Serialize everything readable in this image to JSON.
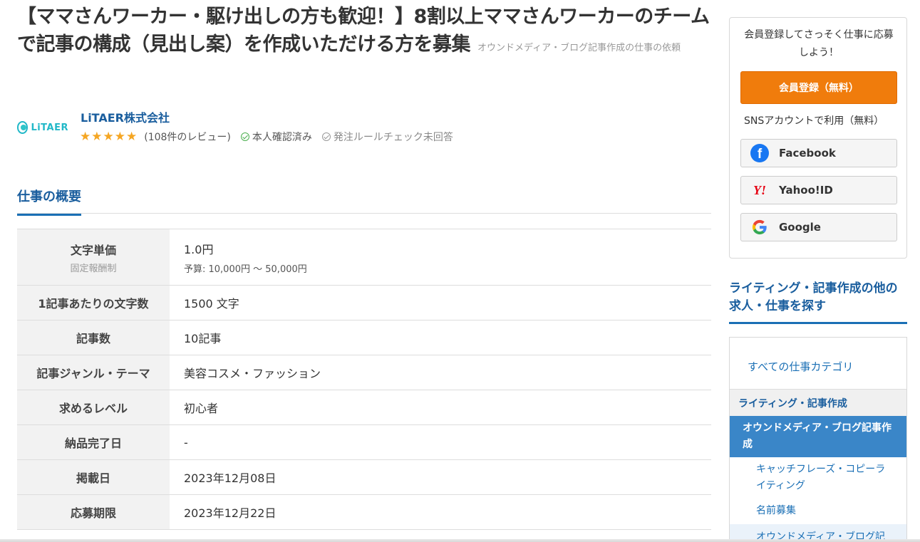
{
  "job": {
    "title": "【ママさんワーカー・駆け出しの方も歓迎！】8割以上ママさんワーカーのチームで記事の構成（見出し案）を作成いただける方を募集",
    "category_label": "オウンドメディア・ブログ記事作成の仕事の依頼"
  },
  "client": {
    "logo_text": "LiTAER",
    "name": "LiTAER株式会社",
    "rating": 5,
    "reviews": "(108件のレビュー)",
    "verified": "本人確認済み",
    "rule_check": "発注ルールチェック未回答"
  },
  "section": {
    "title": "仕事の概要"
  },
  "details": [
    {
      "label": "文字単価",
      "sub": "固定報酬制",
      "value": "1.0円",
      "extra": "予算: 10,000円 〜 50,000円"
    },
    {
      "label": "1記事あたりの文字数",
      "sub": "",
      "value": "1500 文字",
      "extra": ""
    },
    {
      "label": "記事数",
      "sub": "",
      "value": "10記事",
      "extra": ""
    },
    {
      "label": "記事ジャンル・テーマ",
      "sub": "",
      "value": "美容コスメ・ファッション",
      "extra": ""
    },
    {
      "label": "求めるレベル",
      "sub": "",
      "value": "初心者",
      "extra": ""
    },
    {
      "label": "納品完了日",
      "sub": "",
      "value": "-",
      "extra": ""
    },
    {
      "label": "掲載日",
      "sub": "",
      "value": "2023年12月08日",
      "extra": ""
    },
    {
      "label": "応募期限",
      "sub": "",
      "value": "2023年12月22日",
      "extra": ""
    }
  ],
  "sidebar": {
    "signup_message": "会員登録してさっそく仕事に応募しよう！",
    "register_button": "会員登録（無料）",
    "sns_label": "SNSアカウントで利用（無料）",
    "sns": {
      "facebook": "Facebook",
      "yahoo": "Yahoo!ID",
      "google": "Google"
    },
    "other_jobs_heading": "ライティング・記事作成の他の求人・仕事を探す",
    "categories": {
      "all": "すべての仕事カテゴリ",
      "parent": "ライティング・記事作成",
      "active": "オウンドメディア・ブログ記事作成",
      "sub1": "キャッチフレーズ・コピーライティング",
      "sub2": "名前募集",
      "sub3": "オウンドメディア・ブログ記"
    }
  },
  "colors": {
    "link_blue": "#1a5e9e",
    "accent_orange": "#f07c0c",
    "active_category": "#3a86c8",
    "star": "#f5a623"
  }
}
